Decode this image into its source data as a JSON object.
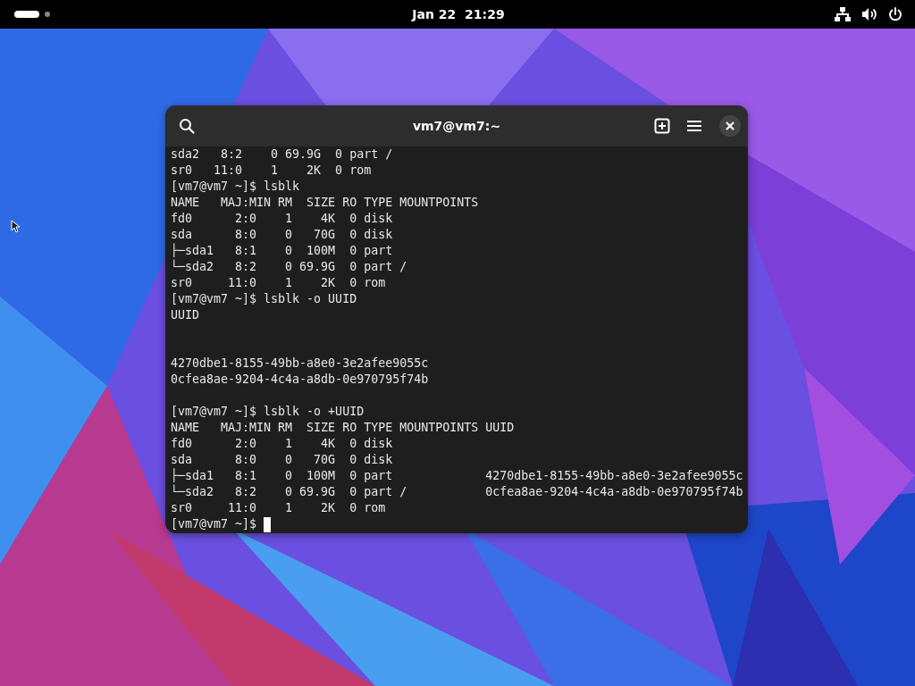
{
  "top_bar": {
    "clock": "Jan 22  21:29"
  },
  "window": {
    "title": "vm7@vm7:~"
  },
  "terminal": {
    "lines": [
      {
        "kind": "text",
        "text": "sda2   8:2    0 69.9G  0 part /"
      },
      {
        "kind": "text",
        "text": "sr0   11:0    1    2K  0 rom"
      },
      {
        "kind": "text",
        "text": "[vm7@vm7 ~]$ lsblk"
      },
      {
        "kind": "text",
        "text": "NAME   MAJ:MIN RM  SIZE RO TYPE MOUNTPOINTS"
      },
      {
        "kind": "text",
        "text": "fd0      2:0    1    4K  0 disk"
      },
      {
        "kind": "text",
        "text": "sda      8:0    0   70G  0 disk"
      },
      {
        "kind": "text",
        "text": "├─sda1   8:1    0  100M  0 part"
      },
      {
        "kind": "text",
        "text": "└─sda2   8:2    0 69.9G  0 part /"
      },
      {
        "kind": "text",
        "text": "sr0     11:0    1    2K  0 rom"
      },
      {
        "kind": "text",
        "text": "[vm7@vm7 ~]$ lsblk -o UUID"
      },
      {
        "kind": "text",
        "text": "UUID"
      },
      {
        "kind": "blank"
      },
      {
        "kind": "blank"
      },
      {
        "kind": "text",
        "text": "4270dbe1-8155-49bb-a8e0-3e2afee9055c"
      },
      {
        "kind": "text",
        "text": "0cfea8ae-9204-4c4a-a8db-0e970795f74b"
      },
      {
        "kind": "blank"
      },
      {
        "kind": "text",
        "text": "[vm7@vm7 ~]$ lsblk -o +UUID"
      },
      {
        "kind": "text",
        "text": "NAME   MAJ:MIN RM  SIZE RO TYPE MOUNTPOINTS UUID"
      },
      {
        "kind": "text",
        "text": "fd0      2:0    1    4K  0 disk"
      },
      {
        "kind": "text",
        "text": "sda      8:0    0   70G  0 disk"
      },
      {
        "kind": "text",
        "text": "├─sda1   8:1    0  100M  0 part             4270dbe1-8155-49bb-a8e0-3e2afee9055c"
      },
      {
        "kind": "text",
        "text": "└─sda2   8:2    0 69.9G  0 part /           0cfea8ae-9204-4c4a-a8db-0e970795f74b"
      },
      {
        "kind": "text",
        "text": "sr0     11:0    1    2K  0 rom"
      },
      {
        "kind": "prompt",
        "text": "[vm7@vm7 ~]$"
      }
    ]
  }
}
